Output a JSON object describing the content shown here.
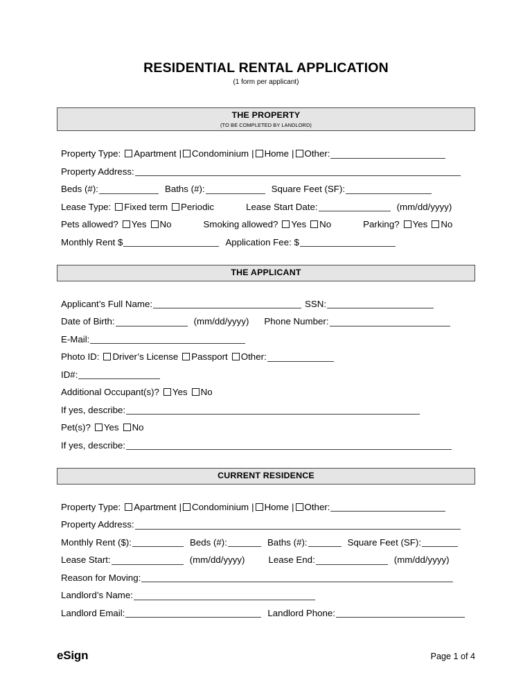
{
  "document": {
    "title": "RESIDENTIAL RENTAL APPLICATION",
    "subtitle": "(1 form per applicant)"
  },
  "sections": [
    {
      "id": "the-property",
      "heading": "THE PROPERTY",
      "subheading": "(TO BE COMPLETED BY LANDLORD)"
    },
    {
      "id": "the-applicant",
      "heading": "THE APPLICANT",
      "subheading": ""
    },
    {
      "id": "current-residence",
      "heading": "CURRENT RESIDENCE",
      "subheading": ""
    }
  ],
  "labels": {
    "property_type": "Property Type:",
    "apartment": "Apartment",
    "condominium": "Condominium",
    "home": "Home",
    "other": "Other:",
    "other_plain": "Other:",
    "pipe": "|",
    "property_address": "Property Address:",
    "beds": "Beds (#):",
    "baths": "Baths (#):",
    "square_feet": "Square Feet (SF):",
    "lease_type": "Lease Type:",
    "fixed_term": "Fixed term",
    "periodic": "Periodic",
    "lease_start_date": "Lease Start Date:",
    "date_format": "(mm/dd/yyyy)",
    "pets_allowed": "Pets allowed?",
    "smoking_allowed": "Smoking allowed?",
    "parking": "Parking?",
    "yes": "Yes",
    "no": "No",
    "monthly_rent": "Monthly Rent $",
    "application_fee": "Application Fee: $",
    "applicant_full_name": "Applicant’s Full Name:",
    "ssn": "SSN:",
    "date_of_birth": "Date of Birth:",
    "phone_number": "Phone Number:",
    "email": "E-Mail:",
    "photo_id": "Photo ID:",
    "drivers_license": "Driver’s License",
    "passport": "Passport",
    "id_number": "ID#:",
    "additional_occupants": "Additional Occupant(s)?",
    "if_yes_describe": "If yes, describe:",
    "pets": "Pet(s)?",
    "monthly_rent_cur": "Monthly Rent ($):",
    "beds_cur": "Beds (#):",
    "baths_cur": "Baths (#):",
    "square_feet_cur": "Square Feet (SF):",
    "lease_start": "Lease Start:",
    "lease_end": "Lease End:",
    "reason_for_moving": "Reason for Moving:",
    "landlord_name": "Landlord’s Name:",
    "landlord_email": "Landlord Email:",
    "landlord_phone": "Landlord Phone:"
  },
  "footer": {
    "brand": "eSign",
    "page": "Page 1 of 4"
  },
  "colors": {
    "section_bar_fill": "#e5e5e5",
    "section_bar_border": "#4a4a4a",
    "text": "#000000",
    "rule": "#3a3a3a"
  }
}
